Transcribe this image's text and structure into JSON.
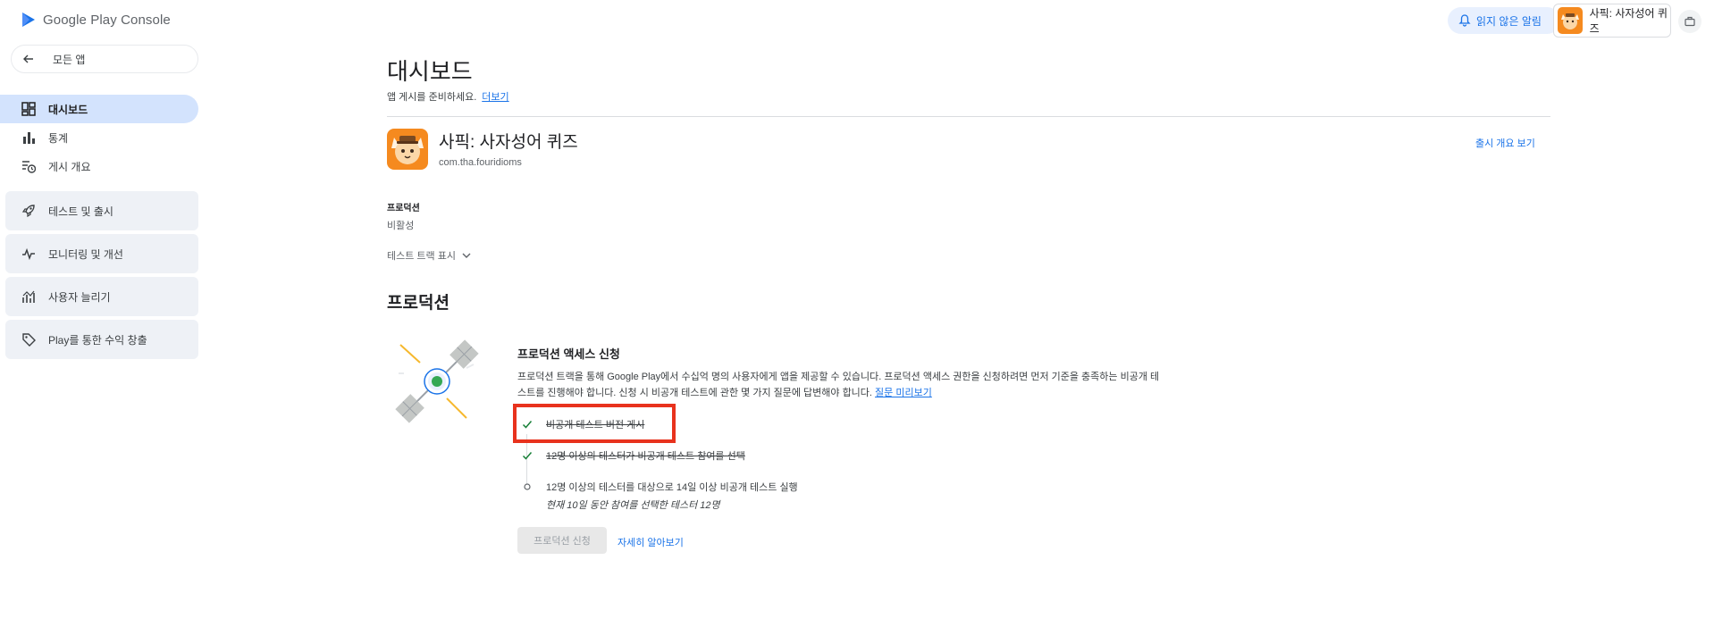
{
  "header": {
    "logo_text": "Google Play Console",
    "notifications_label": "읽지 않은 알림",
    "account_name": "사픽: 사자성어 퀴즈"
  },
  "sidebar": {
    "back_label": "모든 앱",
    "items": [
      {
        "label": "대시보드",
        "icon": "dashboard-icon",
        "active": true
      },
      {
        "label": "통계",
        "icon": "bar-chart-icon",
        "active": false
      },
      {
        "label": "게시 개요",
        "icon": "publishing-overview-icon",
        "active": false
      }
    ],
    "groups": [
      {
        "label": "테스트 및 출시",
        "icon": "rocket-icon"
      },
      {
        "label": "모니터링 및 개선",
        "icon": "vitals-icon"
      },
      {
        "label": "사용자 늘리기",
        "icon": "grow-users-icon"
      },
      {
        "label": "Play를 통한 수익 창출",
        "icon": "tag-icon"
      }
    ]
  },
  "main": {
    "title": "대시보드",
    "subtitle": "앱 게시를 준비하세요.",
    "subtitle_link": "더보기",
    "app_name": "사픽: 사자성어 퀴즈",
    "app_package": "com.tha.fouridioms",
    "release_overview_link": "출시 개요 보기",
    "track_label": "프로덕션",
    "track_status": "비활성",
    "show_tracks": "테스트 트랙 표시",
    "section_title": "프로덕션",
    "card": {
      "title": "프로덕션 액세스 신청",
      "description": "프로덕션 트랙을 통해 Google Play에서 수십억 명의 사용자에게 앱을 제공할 수 있습니다. 프로덕션 액세스 권한을 신청하려면 먼저 기준을 충족하는 비공개 테스트를 진행해야 합니다. 신청 시 비공개 테스트에 관한 몇 가지 질문에 답변해야 합니다.",
      "description_link": "질문 미리보기",
      "steps": [
        {
          "text": "비공개 테스트 버전 게시",
          "done": true
        },
        {
          "text": "12명 이상의 테스터가 비공개 테스트 참여를 선택",
          "done": true
        },
        {
          "text": "12명 이상의 테스터를 대상으로 14일 이상 비공개 테스트 실행",
          "sub": "현재 10일 동안 참여를 선택한 테스터 12명",
          "done": false
        }
      ],
      "apply_button": "프로덕션 신청",
      "learn_more": "자세히 알아보기"
    }
  },
  "colors": {
    "accent": "#1a73e8",
    "active_nav": "#d3e3fd",
    "highlight_box": "#e8321d",
    "app_icon_bg": "#f58a1f"
  }
}
